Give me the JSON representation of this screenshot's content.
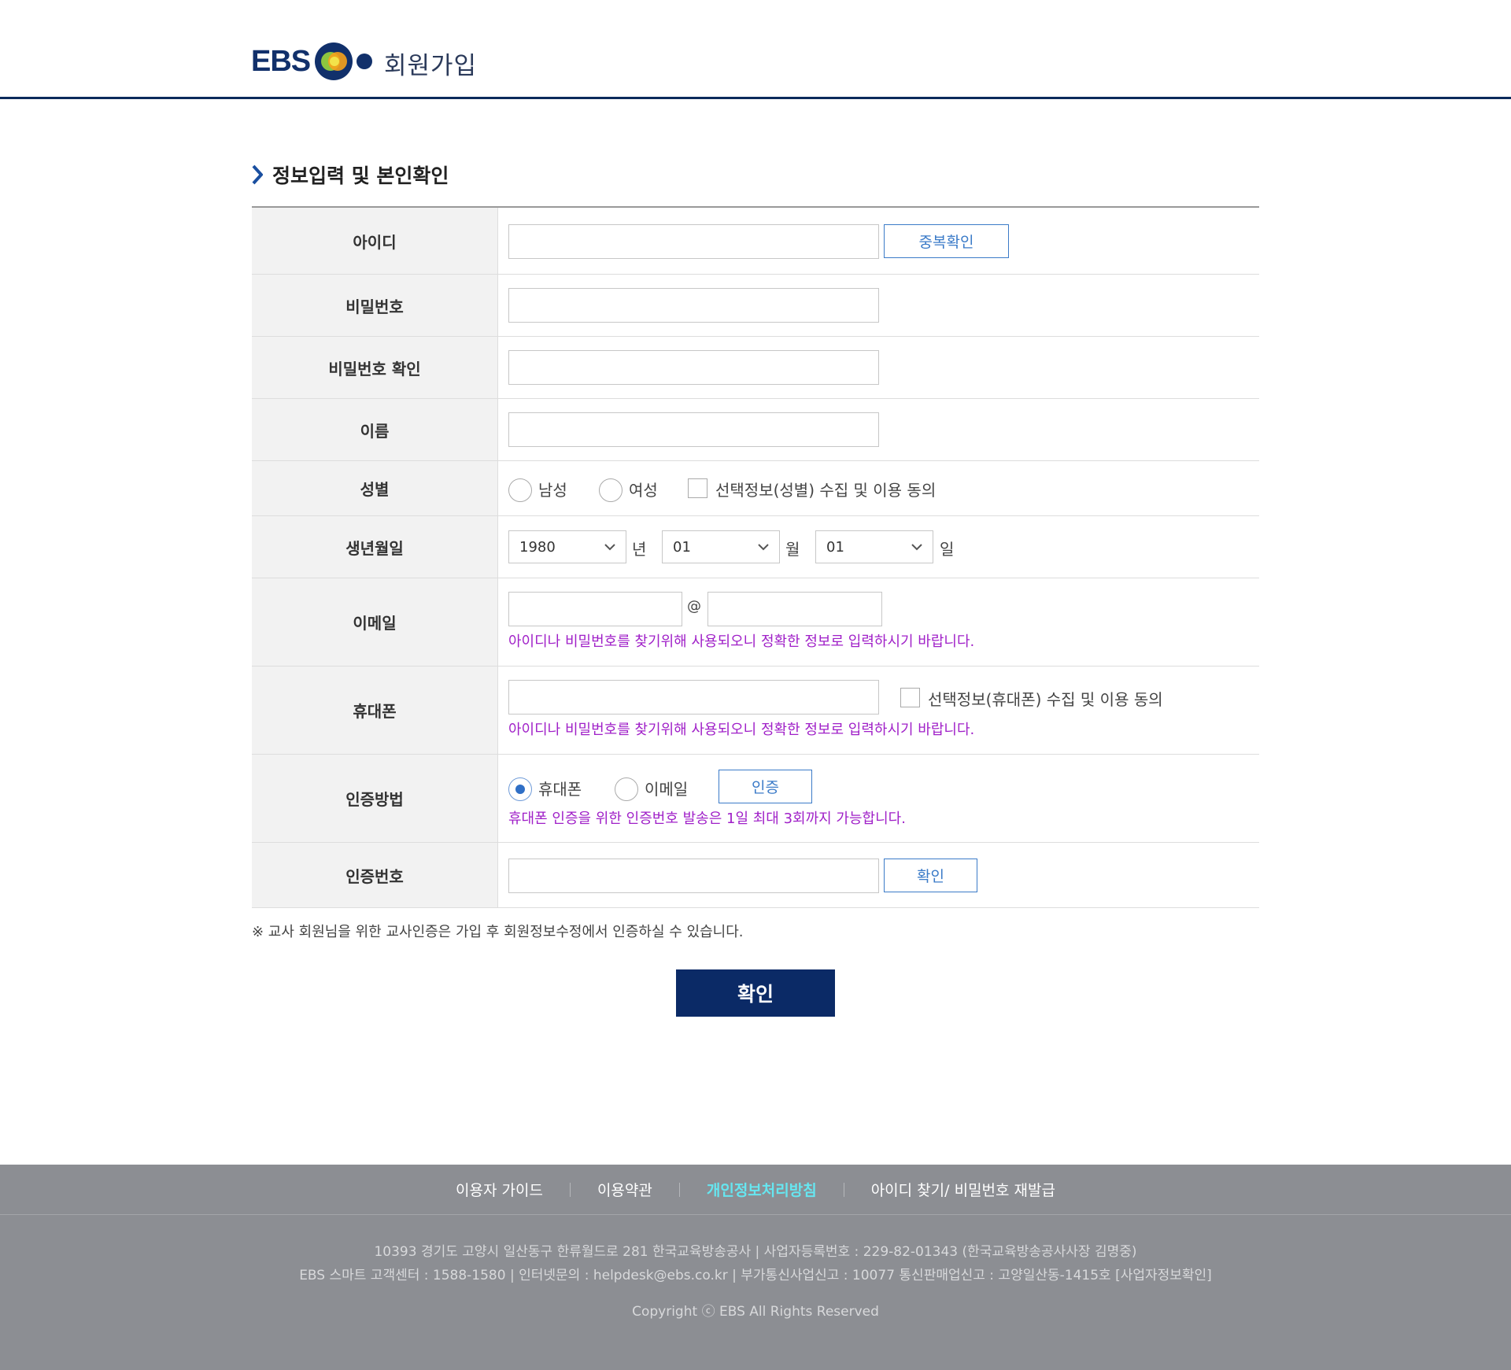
{
  "header": {
    "logo_text": "EBS",
    "title": "회원가입"
  },
  "section": {
    "title": "정보입력 및 본인확인"
  },
  "form": {
    "id_label": "아이디",
    "id_check_button": "중복확인",
    "password_label": "비밀번호",
    "password_confirm_label": "비밀번호 확인",
    "name_label": "이름",
    "gender_label": "성별",
    "gender_male": "남성",
    "gender_female": "여성",
    "gender_consent": "선택정보(성별) 수집 및 이용 동의",
    "birth_label": "생년월일",
    "birth_year": "1980",
    "birth_year_unit": "년",
    "birth_month": "01",
    "birth_month_unit": "월",
    "birth_day": "01",
    "birth_day_unit": "일",
    "email_label": "이메일",
    "email_at": "@",
    "email_note": "아이디나 비밀번호를 찾기위해 사용되오니 정확한 정보로 입력하시기 바랍니다.",
    "phone_label": "휴대폰",
    "phone_consent": "선택정보(휴대폰) 수집 및 이용 동의",
    "phone_note": "아이디나 비밀번호를 찾기위해 사용되오니 정확한 정보로 입력하시기 바랍니다.",
    "auth_method_label": "인증방법",
    "auth_phone": "휴대폰",
    "auth_email": "이메일",
    "auth_button": "인증",
    "auth_note": "휴대폰 인증을 위한 인증번호 발송은 1일 최대 3회까지 가능합니다.",
    "auth_code_label": "인증번호",
    "auth_code_confirm": "확인"
  },
  "teacher_note": "※ 교사 회원님을 위한 교사인증은 가입 후 회원정보수정에서 인증하실 수 있습니다.",
  "submit_label": "확인",
  "footer": {
    "nav": [
      "이용자 가이드",
      "이용약관",
      "개인정보처리방침",
      "아이디 찾기/ 비밀번호 재발급"
    ],
    "address_line1": "10393 경기도 고양시 일산동구 한류월드로 281 한국교육방송공사  |  사업자등록번호 : 229-82-01343 (한국교육방송공사사장 김명중)",
    "address_line2": "EBS 스마트 고객센터 : 1588-1580  |  인터넷문의 : helpdesk@ebs.co.kr  |  부가통신사업신고 : 10077 통신판매업신고 : 고양일산동-1415호 [사업자정보확인]",
    "copyright": "Copyright ⓒ EBS All Rights Reserved"
  },
  "colors": {
    "brand_navy": "#0b2a66",
    "link_blue": "#3b7bc8",
    "note_purple": "#a020c8",
    "footer_bg": "#8c8e93",
    "footer_highlight": "#66e6f0"
  }
}
